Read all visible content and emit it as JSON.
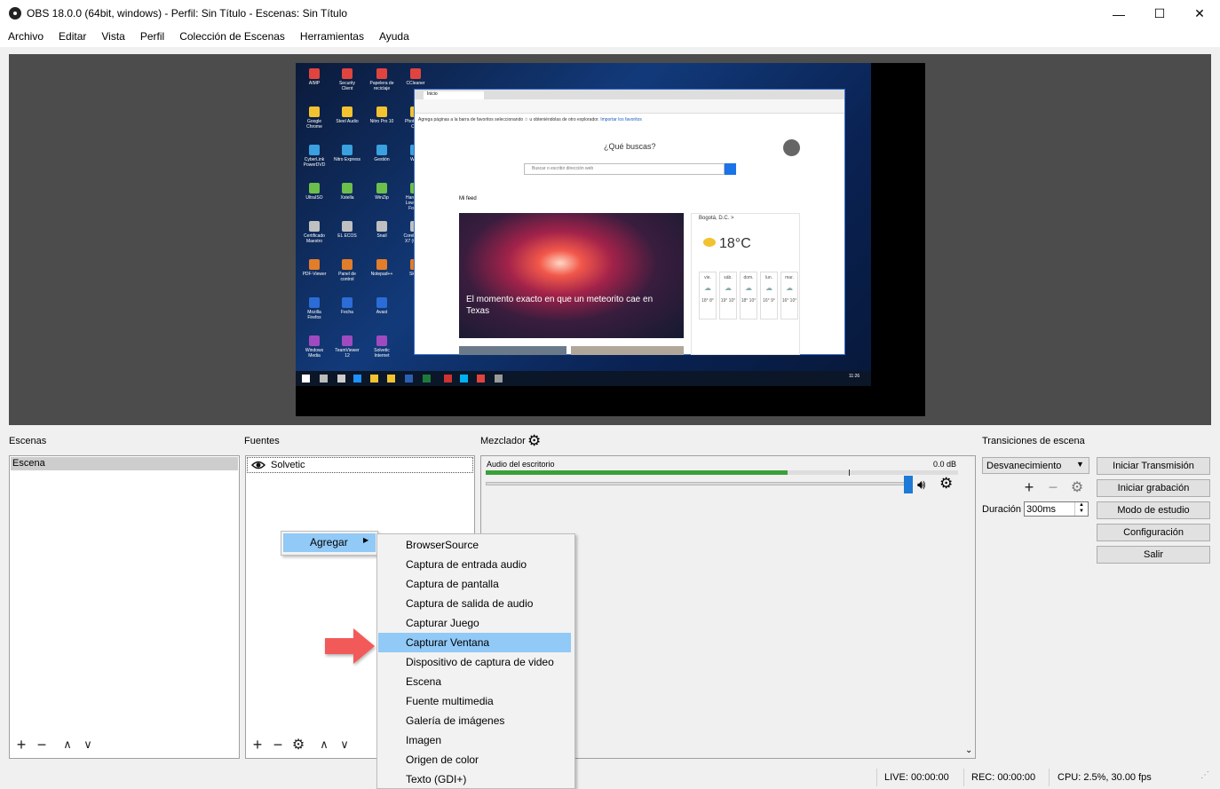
{
  "window": {
    "title": "OBS 18.0.0 (64bit, windows) - Perfil: Sin Título - Escenas: Sin Título",
    "minimize": "—",
    "maximize": "☐",
    "close": "✕"
  },
  "menubar": [
    "Archivo",
    "Editar",
    "Vista",
    "Perfil",
    "Colección de Escenas",
    "Herramientas",
    "Ayuda"
  ],
  "preview": {
    "browser": {
      "tab_label": "Inicio",
      "favorites_bar": "Agrega páginas a la barra de favoritos seleccionando ☆ u obteniéndolas de otro explorador.",
      "favorites_link": "Importar los favoritos",
      "question": "¿Qué buscas?",
      "search_placeholder": "Buscar o escribir dirección web",
      "feed_label": "Mi feed",
      "feed_headline": "El momento exacto en que un meteorito cae en Texas",
      "weather_city": "Bogotá, D.C. >",
      "weather_temp": "18°C",
      "weather_days": [
        {
          "day": "vie.",
          "temps": "18° 8°"
        },
        {
          "day": "sáb.",
          "temps": "19° 10°"
        },
        {
          "day": "dom.",
          "temps": "18° 10°"
        },
        {
          "day": "lun.",
          "temps": "16° 9°"
        },
        {
          "day": "mar.",
          "temps": "16° 10°"
        }
      ]
    },
    "desktop_icons": [
      "AIMP",
      "Google Chrome",
      "CyberLink PowerDVD",
      "UltraISO",
      "Certificado Maestro",
      "PDF-Viewer",
      "Mozilla Firefox",
      "Windows Media",
      "Security Client",
      "Steel Audio",
      "Nitro Express",
      "Xstella",
      "EL ECOS",
      "Panel de control",
      "Fecha",
      "TeamViewer 12",
      "Papelera de reciclaje",
      "Nitro Pro 10",
      "Gestión",
      "WinZip",
      "Snail",
      "Notepad++",
      "Avast",
      "Solvetic Internet",
      "CCleaner",
      "Photoshop CS6",
      "Word",
      "Hard Disk Low Level Format",
      "CorelDRAW X7 (64-Bit)",
      "Skype"
    ],
    "taskbar_time": "11:26"
  },
  "scenes": {
    "label": "Escenas",
    "items": [
      "Escena"
    ]
  },
  "sources": {
    "label": "Fuentes",
    "items": [
      "Solvetic"
    ]
  },
  "mixer": {
    "label": "Mezclador",
    "track_name": "Audio del escritorio",
    "db_value": "0.0 dB",
    "level": 0.64
  },
  "transitions": {
    "label": "Transiciones de escena",
    "selected": "Desvanecimiento",
    "duration_label": "Duración",
    "duration_value": "300ms"
  },
  "controls": {
    "start_stream": "Iniciar Transmisión",
    "start_record": "Iniciar grabación",
    "studio_mode": "Modo de estudio",
    "settings": "Configuración",
    "exit": "Salir"
  },
  "context_menu": {
    "parent": "Agregar",
    "submenu": [
      "BrowserSource",
      "Captura de entrada audio",
      "Captura de pantalla",
      "Captura de salida de audio",
      "Capturar Juego",
      "Capturar Ventana",
      "Dispositivo de captura de video",
      "Escena",
      "Fuente multimedia",
      "Galería de imágenes",
      "Imagen",
      "Origen de color",
      "Texto (GDI+)"
    ],
    "highlighted": "Capturar Ventana"
  },
  "status": {
    "live": "LIVE: 00:00:00",
    "rec": "REC: 00:00:00",
    "cpu": "CPU: 2.5%, 30.00 fps"
  },
  "colors": {
    "highlight": "#91c9f7",
    "meter_green": "#3aa03a",
    "slider_blue": "#1d7ad6",
    "arrow_red": "#f25a5a"
  }
}
